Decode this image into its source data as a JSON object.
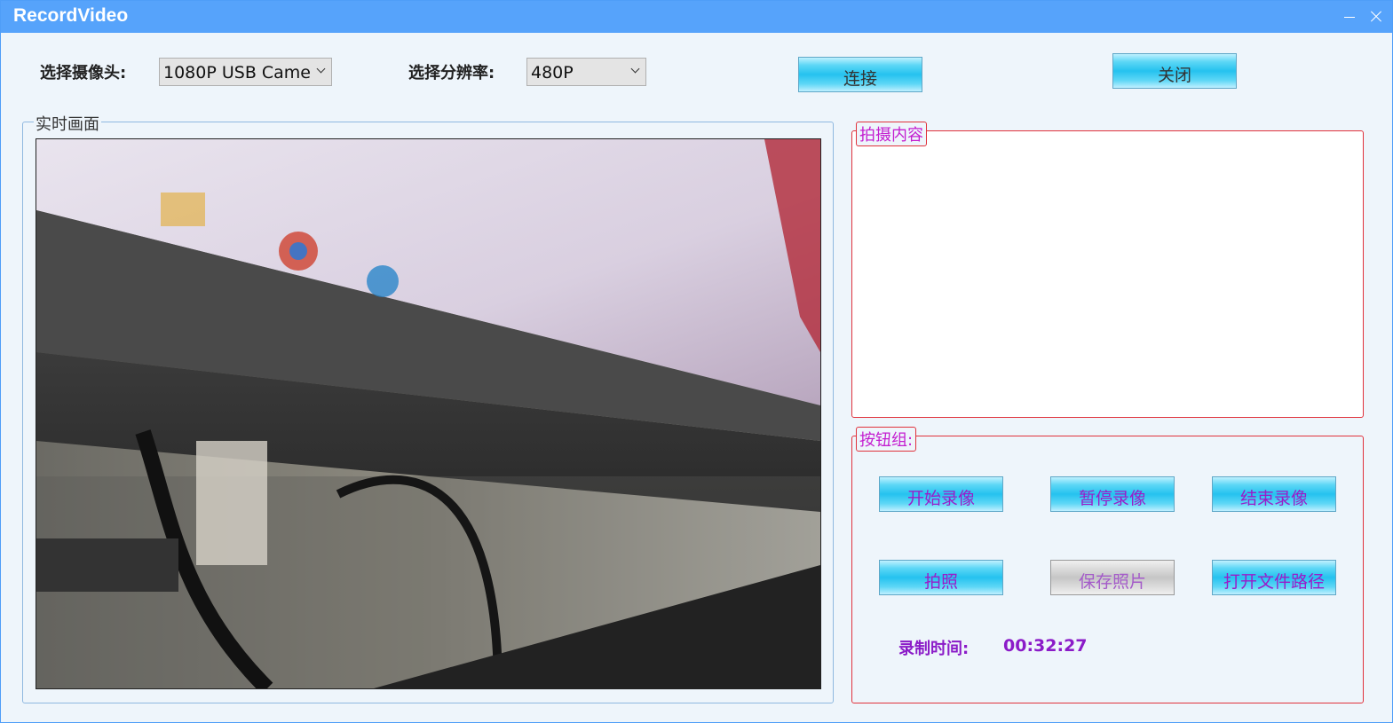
{
  "window": {
    "title": "RecordVideo"
  },
  "toolbar": {
    "camera_label": "选择摄像头:",
    "camera_value": "1080P USB Came",
    "resolution_label": "选择分辨率:",
    "resolution_value": "480P",
    "connect_label": "连接",
    "close_label": "关闭"
  },
  "live": {
    "legend": "实时画面"
  },
  "shot": {
    "legend": "拍摄内容"
  },
  "buttons": {
    "legend": "按钮组:",
    "start": "开始录像",
    "pause": "暂停录像",
    "stop": "结束录像",
    "photo": "拍照",
    "save": "保存照片",
    "open": "打开文件路径"
  },
  "timer": {
    "label": "录制时间:",
    "value": "00:32:27"
  },
  "colors": {
    "accent": "#56a3fb",
    "button": "#25c2ef",
    "group_border": "#e0323c",
    "purple_text": "#8b1bc8"
  }
}
